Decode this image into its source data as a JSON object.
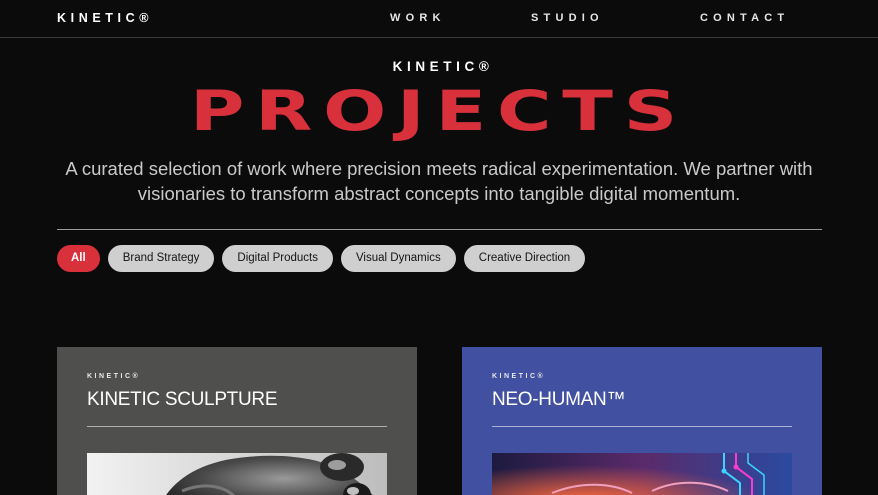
{
  "nav": {
    "brand": "KINETIC®",
    "links": [
      "WORK",
      "STUDIO",
      "CONTACT"
    ]
  },
  "hero": {
    "kicker": "KINETIC®",
    "title": "PROJECTS",
    "description": "A curated selection of work where precision meets radical experimentation. We partner with visionaries to transform abstract concepts into tangible digital momentum."
  },
  "filters": {
    "items": [
      "All",
      "Brand Strategy",
      "Digital Products",
      "Visual Dynamics",
      "Creative Direction"
    ],
    "active": "All"
  },
  "projects": [
    {
      "kicker": "KINETIC®",
      "title": "KINETIC SCULPTURE"
    },
    {
      "kicker": "KINETIC®",
      "title": "NEO-HUMAN™"
    }
  ],
  "colors": {
    "background": "#0b0b0b",
    "accent": "#d8313b",
    "card_gray": "#4f504e",
    "card_blue": "#4150a0",
    "chip": "#cfcfcf"
  }
}
